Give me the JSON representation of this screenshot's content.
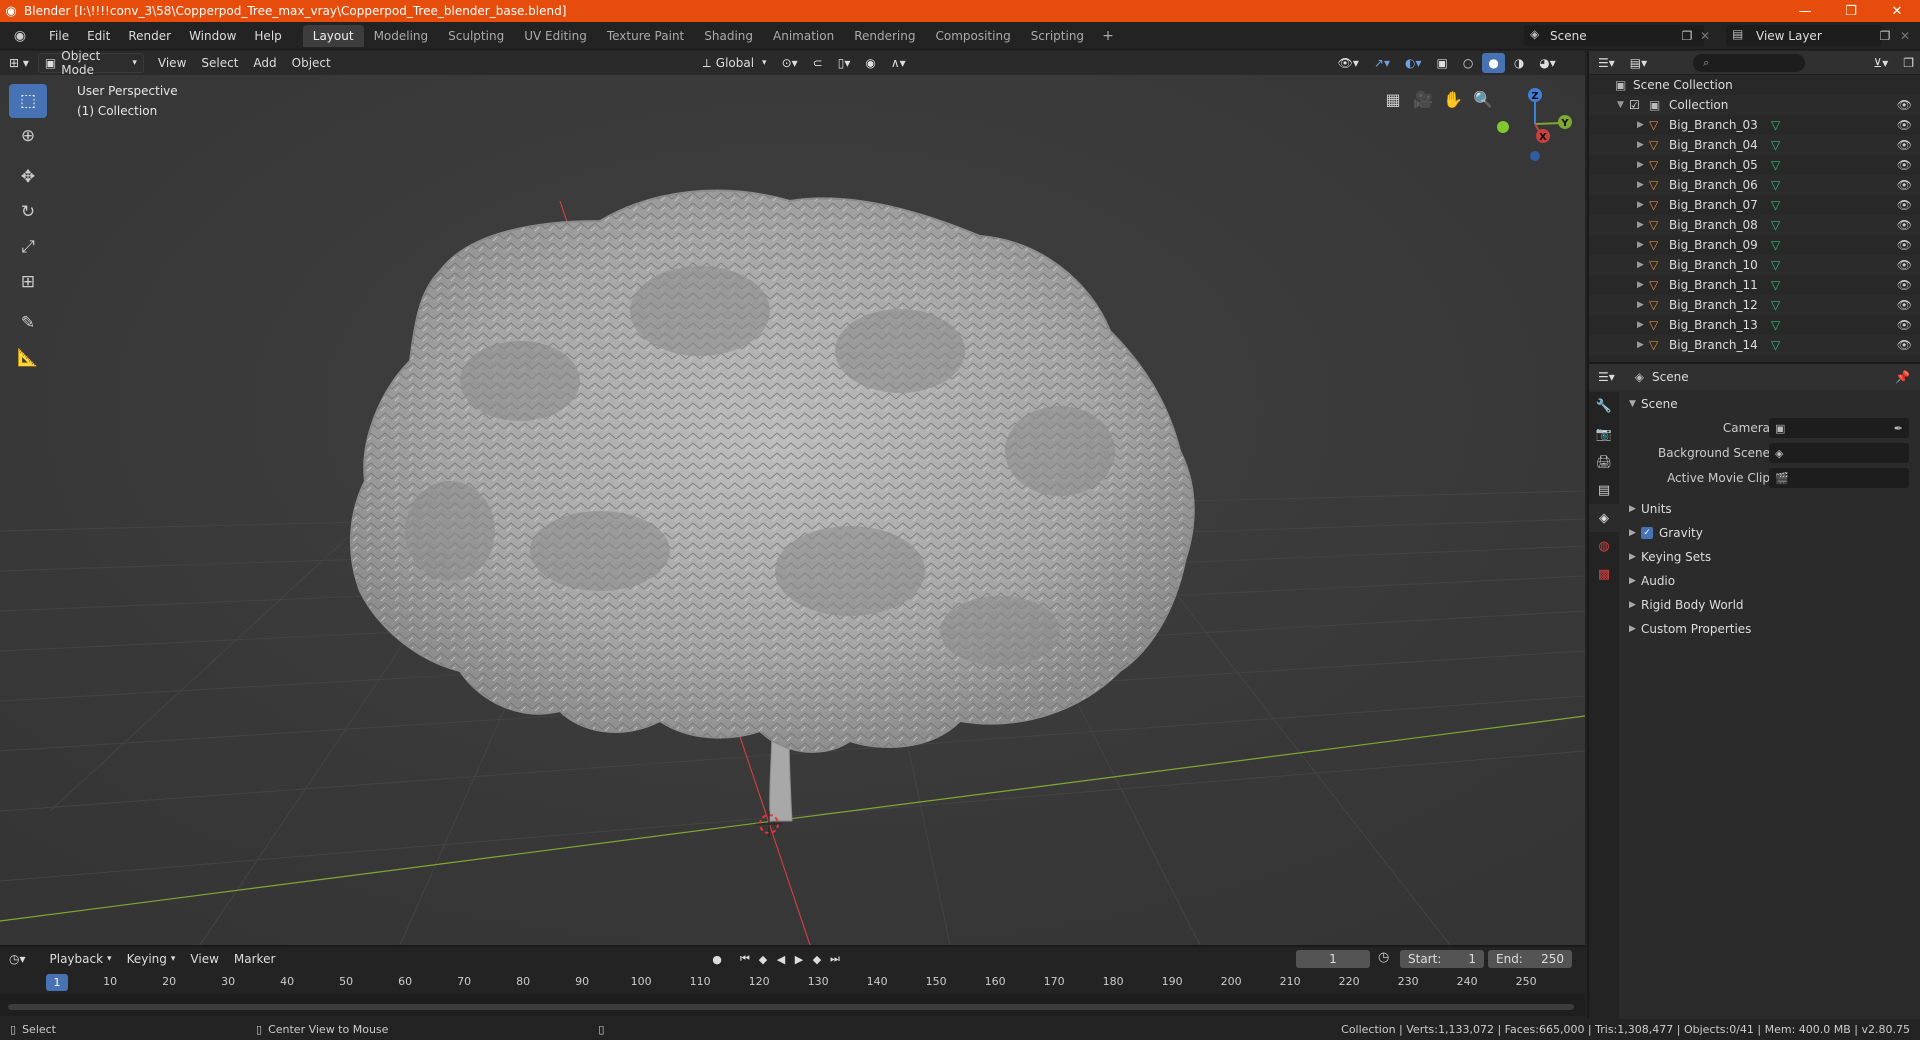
{
  "window": {
    "title": "Blender [I:\\!!!!conv_3\\58\\Copperpod_Tree_max_vray\\Copperpod_Tree_blender_base.blend]",
    "minimize": "—",
    "maximize": "❐",
    "close": "✕"
  },
  "menubar": {
    "items": [
      "File",
      "Edit",
      "Render",
      "Window",
      "Help"
    ]
  },
  "workspaces": {
    "tabs": [
      "Layout",
      "Modeling",
      "Sculpting",
      "UV Editing",
      "Texture Paint",
      "Shading",
      "Animation",
      "Rendering",
      "Compositing",
      "Scripting"
    ],
    "active": "Layout",
    "add": "+"
  },
  "scene_selector": {
    "value": "Scene"
  },
  "view_layer_selector": {
    "value": "View Layer"
  },
  "viewport_header": {
    "mode": "Object Mode",
    "menus": [
      "View",
      "Select",
      "Add",
      "Object"
    ],
    "orientation": "Global"
  },
  "viewport": {
    "perspective_label": "User Perspective",
    "collection_label": "(1) Collection",
    "gizmo_axes": {
      "z": "Z",
      "y": "Y",
      "x": "X"
    }
  },
  "outliner": {
    "scene_collection": "Scene Collection",
    "collection": "Collection",
    "objects": [
      "Big_Branch_03",
      "Big_Branch_04",
      "Big_Branch_05",
      "Big_Branch_06",
      "Big_Branch_07",
      "Big_Branch_08",
      "Big_Branch_09",
      "Big_Branch_10",
      "Big_Branch_11",
      "Big_Branch_12",
      "Big_Branch_13",
      "Big_Branch_14"
    ]
  },
  "properties": {
    "context": "Scene",
    "panel_title": "Scene",
    "camera_label": "Camera",
    "background_scene_label": "Background Scene",
    "active_movie_clip_label": "Active Movie Clip",
    "panels": [
      "Units",
      "Gravity",
      "Keying Sets",
      "Audio",
      "Rigid Body World",
      "Custom Properties"
    ],
    "gravity_checked": true
  },
  "timeline": {
    "menus": [
      "Playback",
      "Keying",
      "View",
      "Marker"
    ],
    "current_frame": "1",
    "start_label": "Start:",
    "start_value": "1",
    "end_label": "End:",
    "end_value": "250",
    "ticks": [
      "10",
      "20",
      "30",
      "40",
      "50",
      "60",
      "70",
      "80",
      "90",
      "100",
      "110",
      "120",
      "130",
      "140",
      "150",
      "160",
      "170",
      "180",
      "190",
      "200",
      "210",
      "220",
      "230",
      "240",
      "250"
    ],
    "current_marker": "1"
  },
  "statusbar": {
    "select": "Select",
    "center_view": "Center View to Mouse",
    "stats": "Collection | Verts:1,133,072 | Faces:665,000 | Tris:1,308,477 | Objects:0/41 | Mem: 400.0 MB | v2.80.75"
  },
  "colors": {
    "titlebar": "#e64d0d",
    "accent": "#4772b3",
    "x_axis": "#c84040",
    "y_axis": "#7fa830",
    "z_axis": "#3f7fd6",
    "mesh_icon": "#e08a3a",
    "mesh_data_icon": "#2ec27e"
  }
}
